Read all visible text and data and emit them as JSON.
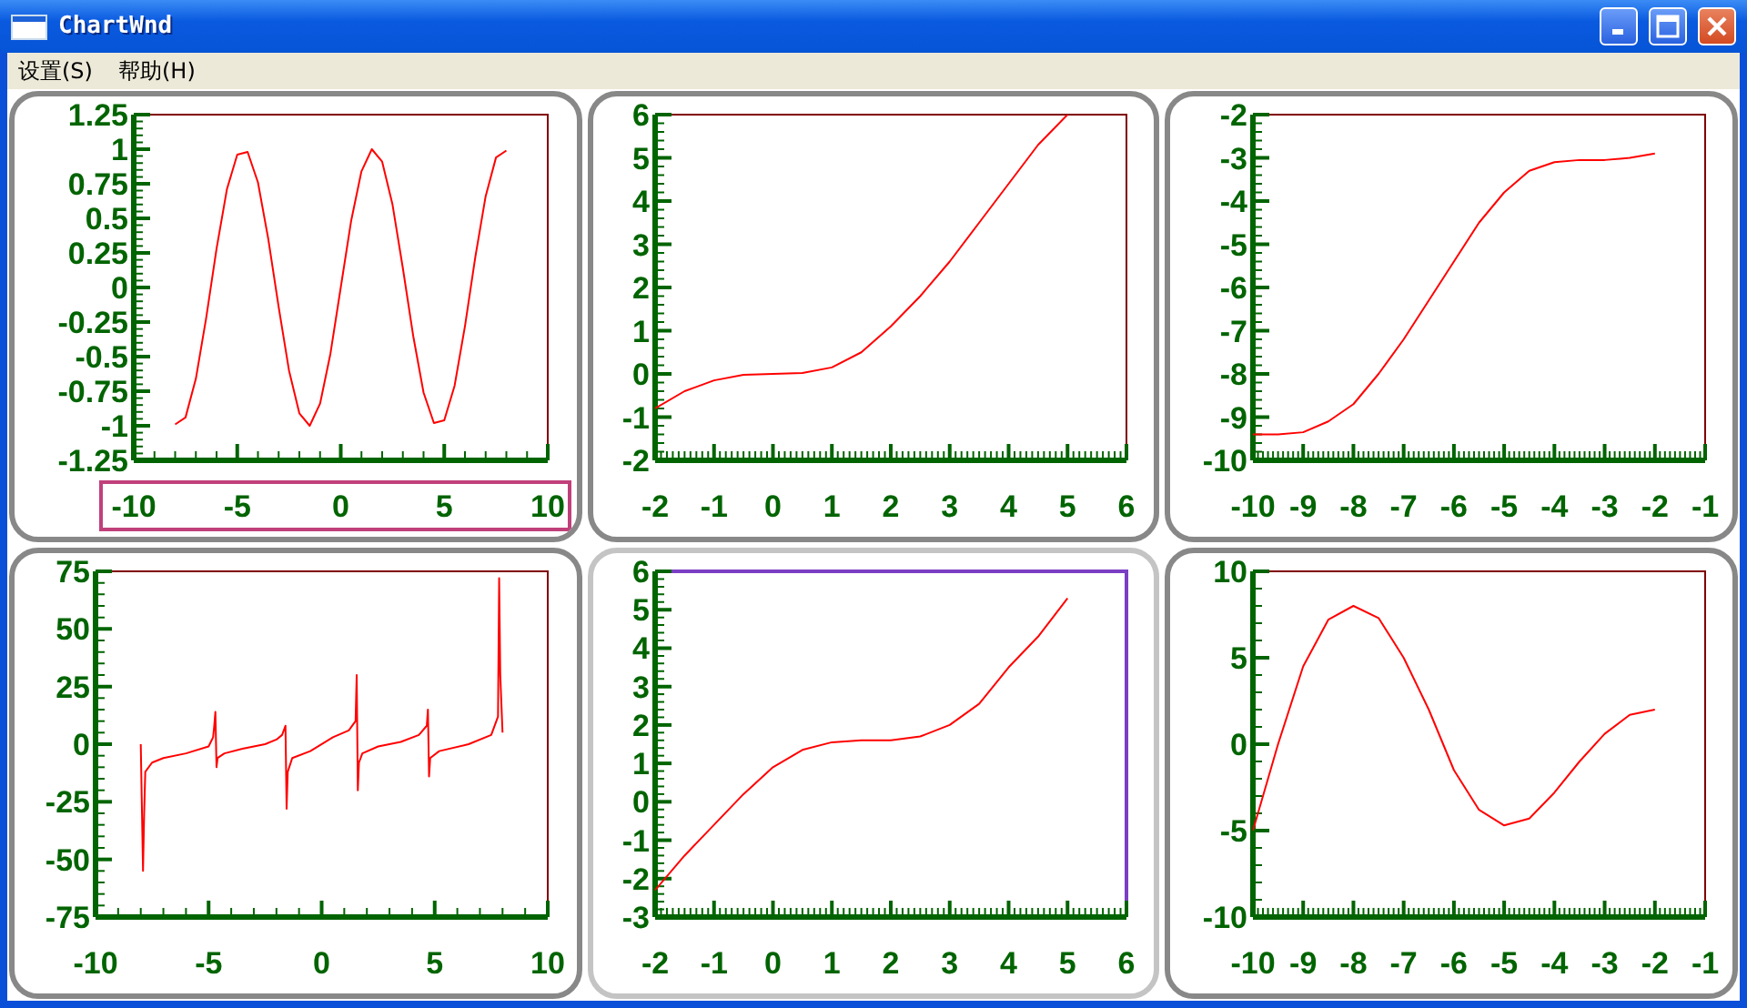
{
  "window": {
    "title": "ChartWnd"
  },
  "menu": [
    {
      "label": "设置(S)"
    },
    {
      "label": "帮助(H)"
    }
  ],
  "charts": [
    {
      "selected": false,
      "x_axis_selected": true,
      "chart_data": {
        "type": "line",
        "xlim": [
          -10,
          10
        ],
        "ylim": [
          -1.25,
          1.25
        ],
        "xticks": [
          -10,
          -5,
          0,
          5,
          10
        ],
        "yticks": [
          -1.25,
          -1,
          -0.75,
          -0.5,
          -0.25,
          0,
          0.25,
          0.5,
          0.75,
          1,
          1.25
        ],
        "x": [
          -8,
          -7.5,
          -7,
          -6.5,
          -6,
          -5.5,
          -5,
          -4.5,
          -4,
          -3.5,
          -3,
          -2.5,
          -2,
          -1.5,
          -1,
          -0.5,
          0,
          0.5,
          1,
          1.5,
          2,
          2.5,
          3,
          3.5,
          4,
          4.5,
          5,
          5.5,
          6,
          6.5,
          7,
          7.5,
          8
        ],
        "series": [
          {
            "color": "#ff0000",
            "values": [
              -0.99,
              -0.94,
              -0.66,
              -0.22,
              0.28,
              0.71,
              0.96,
              0.98,
              0.76,
              0.35,
              -0.14,
              -0.6,
              -0.91,
              -1.0,
              -0.84,
              -0.48,
              0,
              0.48,
              0.84,
              1.0,
              0.91,
              0.6,
              0.14,
              -0.35,
              -0.76,
              -0.98,
              -0.96,
              -0.71,
              -0.28,
              0.22,
              0.66,
              0.94,
              0.99
            ]
          }
        ]
      }
    },
    {
      "selected": false,
      "x_axis_selected": false,
      "chart_data": {
        "type": "line",
        "xlim": [
          -2,
          6
        ],
        "ylim": [
          -2,
          6
        ],
        "xticks": [
          -2,
          -1,
          0,
          1,
          2,
          3,
          4,
          5,
          6
        ],
        "yticks": [
          -2,
          -1,
          0,
          1,
          2,
          3,
          4,
          5,
          6
        ],
        "x": [
          -2,
          -1.5,
          -1,
          -0.5,
          0,
          0.5,
          1,
          1.5,
          2,
          2.5,
          3,
          3.5,
          4,
          4.5,
          5
        ],
        "series": [
          {
            "color": "#ff0000",
            "values": [
              -0.8,
              -0.4,
              -0.15,
              -0.02,
              0,
              0.02,
              0.15,
              0.5,
              1.1,
              1.8,
              2.6,
              3.5,
              4.4,
              5.3,
              6
            ]
          }
        ]
      }
    },
    {
      "selected": false,
      "x_axis_selected": false,
      "chart_data": {
        "type": "line",
        "xlim": [
          -10,
          -1
        ],
        "ylim": [
          -10,
          -2
        ],
        "xticks": [
          -10,
          -9,
          -8,
          -7,
          -6,
          -5,
          -4,
          -3,
          -2,
          -1
        ],
        "yticks": [
          -10,
          -9,
          -8,
          -7,
          -6,
          -5,
          -4,
          -3,
          -2
        ],
        "x": [
          -10,
          -9.5,
          -9,
          -8.5,
          -8,
          -7.5,
          -7,
          -6.5,
          -6,
          -5.5,
          -5,
          -4.5,
          -4,
          -3.5,
          -3,
          -2.5,
          -2
        ],
        "series": [
          {
            "color": "#ff0000",
            "values": [
              -9.4,
              -9.4,
              -9.35,
              -9.1,
              -8.7,
              -8.0,
              -7.2,
              -6.3,
              -5.4,
              -4.5,
              -3.8,
              -3.3,
              -3.1,
              -3.05,
              -3.05,
              -3.0,
              -2.9
            ]
          }
        ]
      }
    },
    {
      "selected": false,
      "x_axis_selected": false,
      "chart_data": {
        "type": "line",
        "xlim": [
          -10,
          10
        ],
        "ylim": [
          -75,
          75
        ],
        "xticks": [
          -10,
          -5,
          0,
          5,
          10
        ],
        "yticks": [
          -75,
          -50,
          -25,
          0,
          25,
          50,
          75
        ],
        "x": [
          -8,
          -7.9,
          -7.85,
          -7.8,
          -7.5,
          -7,
          -6,
          -5,
          -4.8,
          -4.75,
          -4.7,
          -4.65,
          -4.6,
          -4.3,
          -3.5,
          -2.5,
          -2,
          -1.75,
          -1.6,
          -1.55,
          -1.5,
          -1.3,
          -0.5,
          0.5,
          1.2,
          1.5,
          1.55,
          1.6,
          1.65,
          1.8,
          2.5,
          3.5,
          4.3,
          4.65,
          4.7,
          4.75,
          4.8,
          5.2,
          6.5,
          7.5,
          7.8,
          7.85,
          7.9,
          8
        ],
        "series": [
          {
            "color": "#ff0000",
            "values": [
              0,
              -55,
              -30,
              -12,
              -8,
              -6,
              -4,
              -1,
              3,
              8,
              14,
              -10,
              -6,
              -4,
              -2,
              0,
              2,
              4,
              8,
              -28,
              -12,
              -6,
              -3,
              3,
              6,
              10,
              30,
              -20,
              -8,
              -4,
              -1,
              1,
              4,
              8,
              15,
              -14,
              -6,
              -3,
              0,
              4,
              12,
              72,
              30,
              5
            ]
          }
        ]
      }
    },
    {
      "selected": true,
      "x_axis_selected": false,
      "chart_data": {
        "type": "line",
        "xlim": [
          -2,
          6
        ],
        "ylim": [
          -3,
          6
        ],
        "xticks": [
          -2,
          -1,
          0,
          1,
          2,
          3,
          4,
          5,
          6
        ],
        "yticks": [
          -3,
          -2,
          -1,
          0,
          1,
          2,
          3,
          4,
          5,
          6
        ],
        "x": [
          -2,
          -1.5,
          -1,
          -0.5,
          0,
          0.5,
          1,
          1.5,
          2,
          2.5,
          3,
          3.5,
          4,
          4.5,
          5
        ],
        "series": [
          {
            "color": "#ff0000",
            "values": [
              -2.3,
              -1.4,
              -0.6,
              0.2,
              0.9,
              1.35,
              1.55,
              1.6,
              1.6,
              1.7,
              2,
              2.55,
              3.5,
              4.3,
              5.3
            ]
          }
        ]
      }
    },
    {
      "selected": false,
      "x_axis_selected": false,
      "chart_data": {
        "type": "line",
        "xlim": [
          -10,
          -1
        ],
        "ylim": [
          -10,
          10
        ],
        "xticks": [
          -10,
          -9,
          -8,
          -7,
          -6,
          -5,
          -4,
          -3,
          -2,
          -1
        ],
        "yticks": [
          -10,
          -5,
          0,
          5,
          10
        ],
        "x": [
          -10,
          -9.5,
          -9,
          -8.5,
          -8,
          -7.5,
          -7,
          -6.5,
          -6,
          -5.5,
          -5,
          -4.5,
          -4,
          -3.5,
          -3,
          -2.5,
          -2
        ],
        "series": [
          {
            "color": "#ff0000",
            "values": [
              -5,
              0,
              4.5,
              7.2,
              8,
              7.3,
              5,
              2,
              -1.5,
              -3.8,
              -4.7,
              -4.3,
              -2.8,
              -1,
              0.6,
              1.7,
              2
            ]
          }
        ]
      }
    }
  ]
}
